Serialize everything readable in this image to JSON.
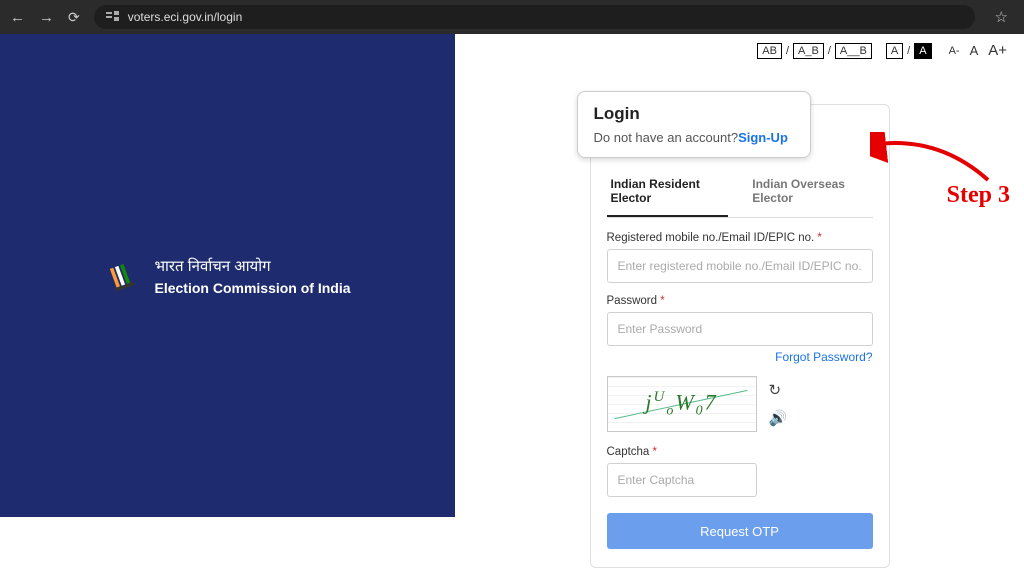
{
  "browser": {
    "url": "voters.eci.gov.in/login"
  },
  "accessibility": {
    "ab1": "AB",
    "ab2": "A_B",
    "ab3": "A__B",
    "a_light": "A",
    "a_dark": "A",
    "a_minus": "A-",
    "a_norm": "A",
    "a_plus": "A+",
    "sep": "/"
  },
  "branding": {
    "hindi": "भारत निर्वाचन आयोग",
    "english": "Election Commission of India"
  },
  "login": {
    "title": "Login",
    "no_account": "Do not have an account?",
    "signup": "Sign-Up"
  },
  "tabs": {
    "resident": "Indian Resident Elector",
    "overseas": "Indian Overseas Elector"
  },
  "form": {
    "mobile_label": "Registered mobile no./Email ID/EPIC no.",
    "mobile_placeholder": "Enter registered mobile no./Email ID/EPIC no.",
    "password_label": "Password",
    "password_placeholder": "Enter Password",
    "forgot": "Forgot Password?",
    "captcha_text": "jUoW07",
    "captcha_label": "Captcha",
    "captcha_placeholder": "Enter Captcha",
    "submit": "Request OTP",
    "required": " *"
  },
  "annotation": {
    "step": "Step 3"
  }
}
